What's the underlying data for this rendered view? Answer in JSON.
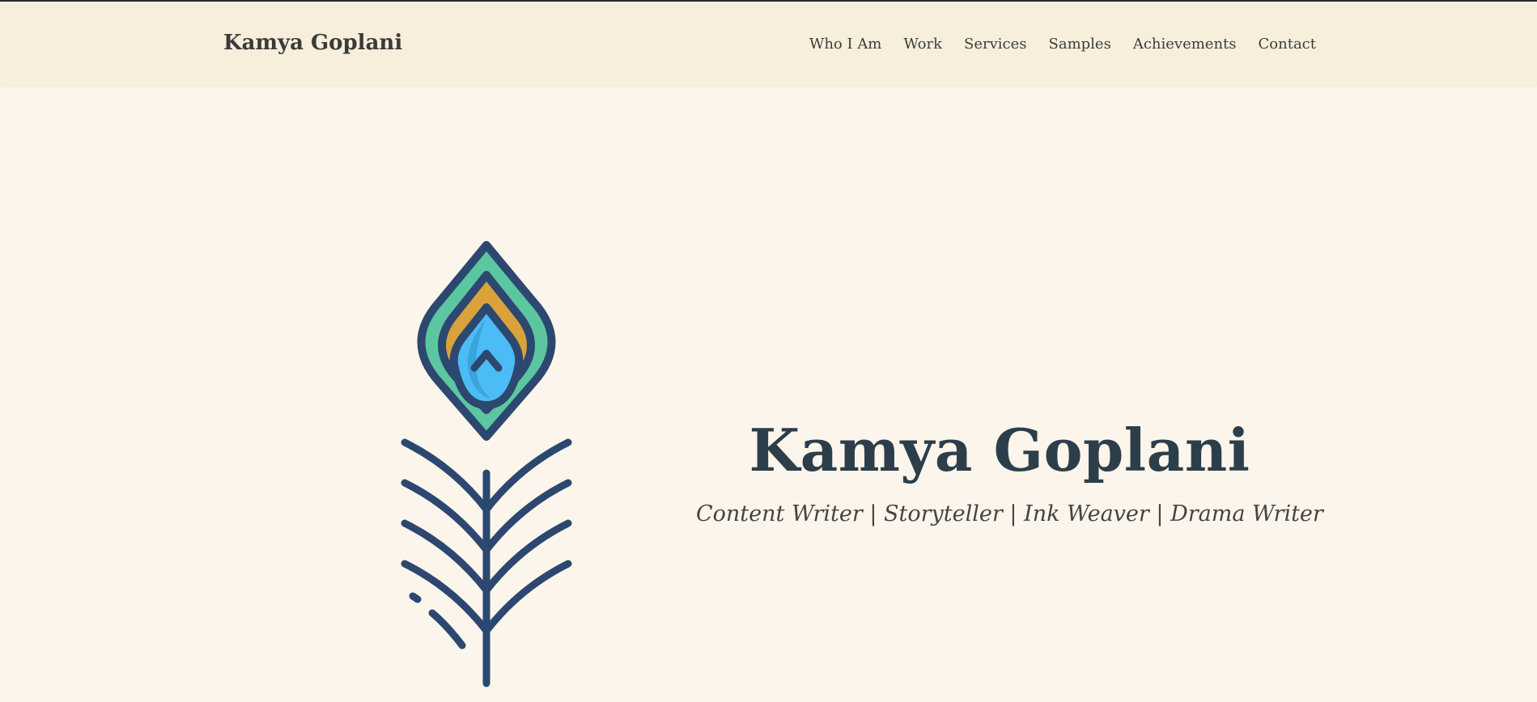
{
  "brand": {
    "name": "Kamya Goplani"
  },
  "nav": {
    "items": [
      "Who I Am",
      "Work",
      "Services",
      "Samples",
      "Achievements",
      "Contact"
    ]
  },
  "hero": {
    "title": "Kamya Goplani",
    "subtitle": "Content Writer | Storyteller | Ink Weaver | Drama Writer",
    "image_icon": "peacock-feather-icon"
  },
  "colors": {
    "page_background": "#fcf5eb",
    "header_background": "#f7efdc",
    "title_color": "#2c3e4a",
    "feather_outline": "#2c4870",
    "feather_green": "#5cc6a0",
    "feather_gold": "#d9a23a",
    "feather_blue": "#4bbcf5"
  }
}
